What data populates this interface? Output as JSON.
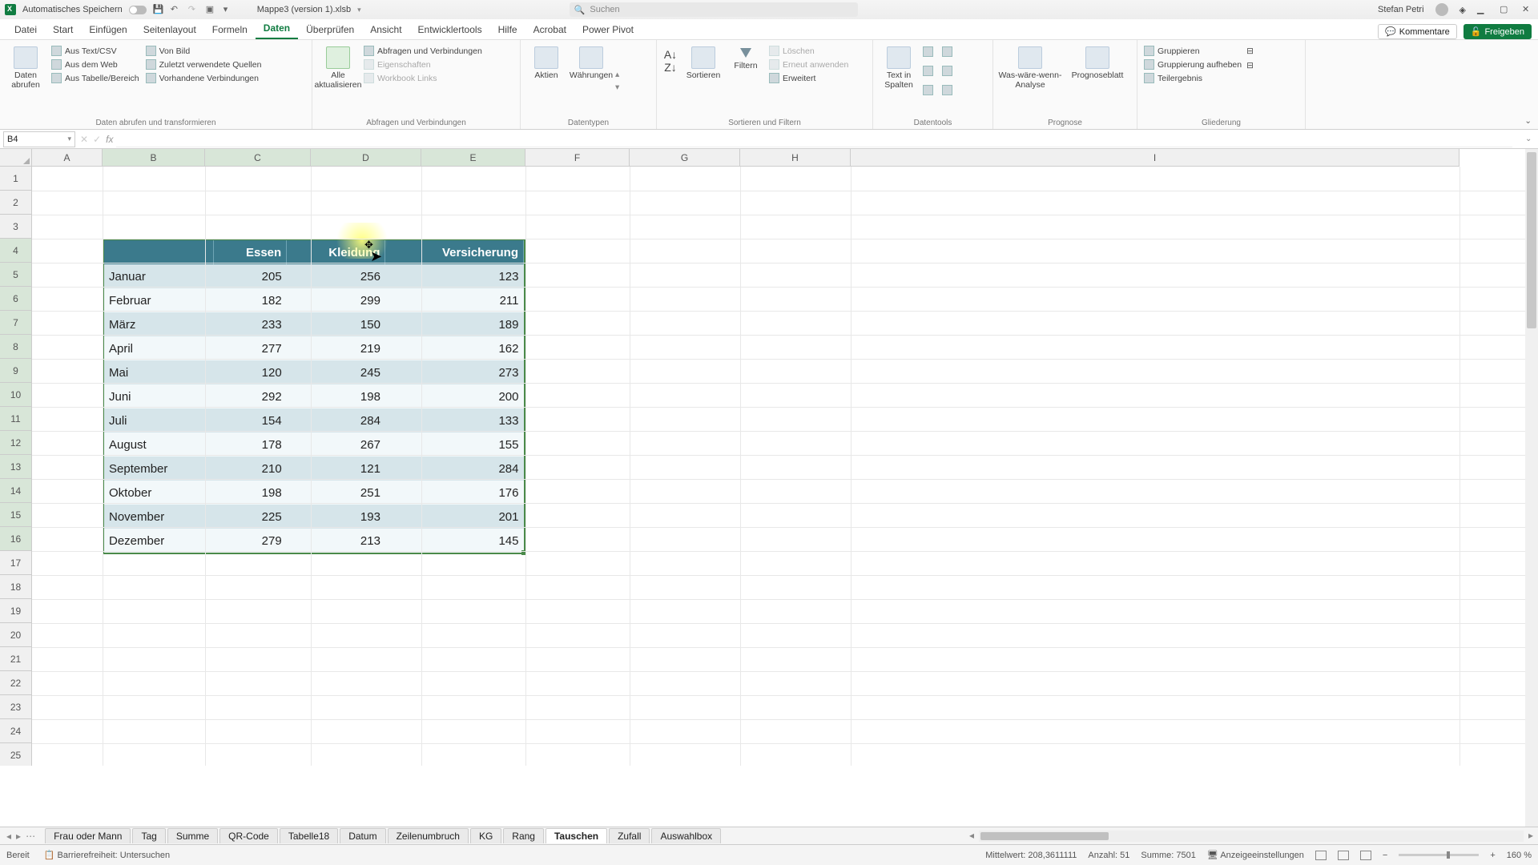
{
  "title_bar": {
    "autosave": "Automatisches Speichern",
    "filename": "Mappe3 (version 1).xlsb",
    "search_placeholder": "Suchen",
    "user": "Stefan Petri"
  },
  "ribbon_tabs": [
    "Datei",
    "Start",
    "Einfügen",
    "Seitenlayout",
    "Formeln",
    "Daten",
    "Überprüfen",
    "Ansicht",
    "Entwicklertools",
    "Hilfe",
    "Acrobat",
    "Power Pivot"
  ],
  "ribbon_tabs_active": "Daten",
  "ribbon_right": {
    "comments": "Kommentare",
    "share": "Freigeben"
  },
  "ribbon_groups": {
    "g1": {
      "big": "Daten abrufen",
      "items": [
        "Aus Text/CSV",
        "Aus dem Web",
        "Aus Tabelle/Bereich",
        "Von Bild",
        "Zuletzt verwendete Quellen",
        "Vorhandene Verbindungen"
      ],
      "label": "Daten abrufen und transformieren"
    },
    "g2": {
      "big": "Alle aktualisieren",
      "items": [
        "Abfragen und Verbindungen",
        "Eigenschaften",
        "Workbook Links"
      ],
      "label": "Abfragen und Verbindungen"
    },
    "g3": {
      "a": "Aktien",
      "b": "Währungen",
      "label": "Datentypen"
    },
    "g4": {
      "sort": "Sortieren",
      "filter": "Filtern",
      "items": [
        "Löschen",
        "Erneut anwenden",
        "Erweitert"
      ],
      "label": "Sortieren und Filtern"
    },
    "g5": {
      "big": "Text in Spalten",
      "label": "Datentools"
    },
    "g6": {
      "a": "Was-wäre-wenn-Analyse",
      "b": "Prognoseblatt",
      "label": "Prognose"
    },
    "g7": {
      "items": [
        "Gruppieren",
        "Gruppierung aufheben",
        "Teilergebnis"
      ],
      "label": "Gliederung"
    }
  },
  "name_box": "B4",
  "columns": [
    "A",
    "B",
    "C",
    "D",
    "E",
    "F",
    "G",
    "H",
    "I"
  ],
  "row_count": 26,
  "chart_data": {
    "type": "table",
    "headers": [
      "",
      "Essen",
      "Kleidung",
      "Versicherung"
    ],
    "rows": [
      [
        "Januar",
        205,
        256,
        123
      ],
      [
        "Februar",
        182,
        299,
        211
      ],
      [
        "März",
        233,
        150,
        189
      ],
      [
        "April",
        277,
        219,
        162
      ],
      [
        "Mai",
        120,
        245,
        273
      ],
      [
        "Juni",
        292,
        198,
        200
      ],
      [
        "Juli",
        154,
        284,
        133
      ],
      [
        "August",
        178,
        267,
        155
      ],
      [
        "September",
        210,
        121,
        284
      ],
      [
        "Oktober",
        198,
        251,
        176
      ],
      [
        "November",
        225,
        193,
        201
      ],
      [
        "Dezember",
        279,
        213,
        145
      ]
    ]
  },
  "sheet_tabs": [
    "Frau oder Mann",
    "Tag",
    "Summe",
    "QR-Code",
    "Tabelle18",
    "Datum",
    "Zeilenumbruch",
    "KG",
    "Rang",
    "Tauschen",
    "Zufall",
    "Auswahlbox"
  ],
  "sheet_active": "Tauschen",
  "status": {
    "ready": "Bereit",
    "access": "Barrierefreiheit: Untersuchen",
    "avg_label": "Mittelwert:",
    "avg": "208,3611111",
    "count_label": "Anzahl:",
    "count": "51",
    "sum_label": "Summe:",
    "sum": "7501",
    "display": "Anzeigeeinstellungen",
    "zoom": "160 %"
  }
}
